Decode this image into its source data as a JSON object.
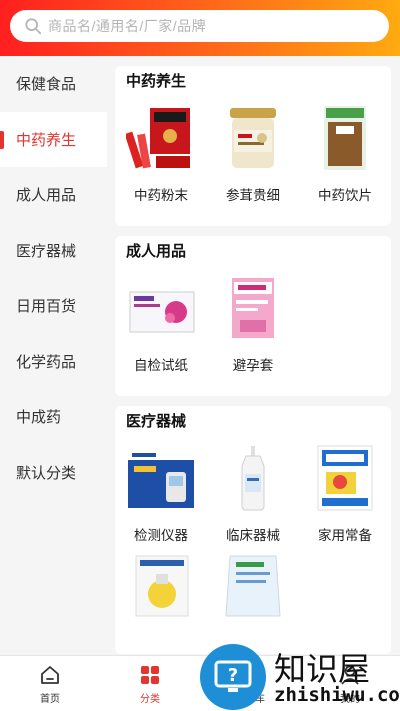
{
  "search": {
    "placeholder": "商品名/通用名/厂家/品牌"
  },
  "sidebar": {
    "items": [
      {
        "label": "保健食品"
      },
      {
        "label": "中药养生"
      },
      {
        "label": "成人用品"
      },
      {
        "label": "医疗器械"
      },
      {
        "label": "日用百货"
      },
      {
        "label": "化学药品"
      },
      {
        "label": "中成药"
      },
      {
        "label": "默认分类"
      }
    ],
    "active": "中药养生"
  },
  "sections": [
    {
      "title": "中药养生",
      "products": [
        {
          "name": "中药粉末"
        },
        {
          "name": "参茸贵细"
        },
        {
          "name": "中药饮片"
        }
      ]
    },
    {
      "title": "成人用品",
      "products": [
        {
          "name": "自检试纸"
        },
        {
          "name": "避孕套"
        }
      ]
    },
    {
      "title": "医疗器械",
      "products": [
        {
          "name": "检测仪器"
        },
        {
          "name": "临床器械"
        },
        {
          "name": "家用常备"
        },
        {
          "name": ""
        },
        {
          "name": ""
        }
      ]
    }
  ],
  "tabbar": {
    "tabs": [
      {
        "label": "首页"
      },
      {
        "label": "分类"
      },
      {
        "label": "购物车"
      },
      {
        "label": "我的"
      }
    ],
    "active": "分类"
  },
  "watermark": {
    "brand": "知识屋",
    "site": "zhishiwu.com"
  },
  "colors": {
    "accent": "#e3342f",
    "gradient_start": "#ff1f1f",
    "gradient_end": "#ffaa10"
  }
}
